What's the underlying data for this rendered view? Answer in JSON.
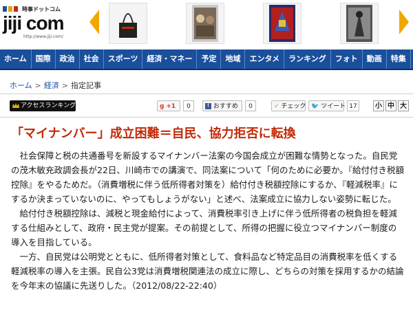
{
  "header": {
    "logo_small": "時事ドットコム",
    "logo_main": "jiji com",
    "logo_url": "http://www.jiji.com/"
  },
  "nav": [
    {
      "label": "ホーム"
    },
    {
      "label": "国際"
    },
    {
      "label": "政治"
    },
    {
      "label": "社会"
    },
    {
      "label": "スポーツ"
    },
    {
      "label": "経済・マネー"
    },
    {
      "label": "予定"
    },
    {
      "label": "地域"
    },
    {
      "label": "エンタメ"
    },
    {
      "label": "ランキング"
    },
    {
      "label": "フォト"
    },
    {
      "label": "動画"
    },
    {
      "label": "特集"
    }
  ],
  "breadcrumb": {
    "home": "ホーム",
    "section": "経済",
    "current": "指定記事",
    "separator": ">"
  },
  "toolbar": {
    "ranking_label": "アクセスランキング",
    "gplus_label": "+1",
    "gplus_count": "0",
    "recommend_label": "おすすめ",
    "recommend_count": "0",
    "check_label": "チェック",
    "tweet_label": "ツイート",
    "tweet_count": "17",
    "size_small": "小",
    "size_medium": "中",
    "size_large": "大"
  },
  "article": {
    "headline": "「マイナンバー」成立困難＝自民、協力拒否に転換",
    "paragraphs": [
      "社会保障と税の共通番号を新設するマイナンバー法案の今国会成立が困難な情勢となった。自民党の茂木敏充政調会長が22日、川崎市での講演で、同法案について「何のために必要か。『給付付き税額控除』をやるためだ。（消費増税に伴う低所得者対策を）給付付き税額控除にするか、『軽減税率』にするか決まっていないのに、やってもしょうがない」と述べ、法案成立に協力しない姿勢に転じた。",
      "給付付き税額控除は、減税と現金給付によって、消費税率引き上げに伴う低所得者の税負担を軽減する仕組みとして、政府・民主党が提案。その前提として、所得の把握に役立つマイナンバー制度の導入を目指している。",
      "一方、自民党は公明党とともに、低所得者対策として、食料品など特定品目の消費税率を低くする軽減税率の導入を主張。民自公3党は消費増税関連法の成立に際し、どちらの対策を採用するかの結論を今年末の協議に先送りした。（2012/08/22-22:40）"
    ]
  },
  "colors": {
    "nav_bg": "#1a4f9c",
    "headline": "#c22a08",
    "link": "#1a4f9c"
  }
}
